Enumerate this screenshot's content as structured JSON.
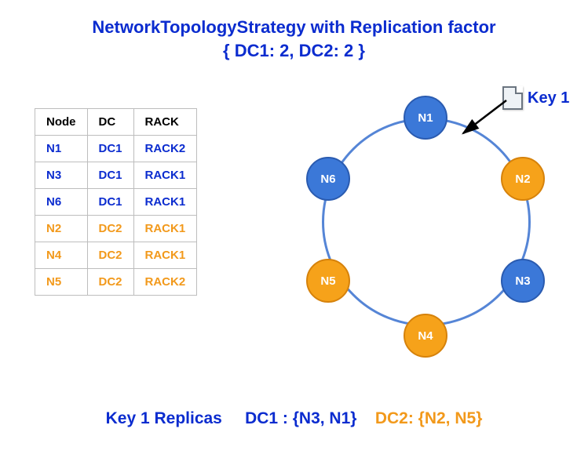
{
  "title_line1": "NetworkTopologyStrategy with Replication factor",
  "title_line2": "{ DC1: 2, DC2: 2 }",
  "table": {
    "headers": {
      "node": "Node",
      "dc": "DC",
      "rack": "RACK"
    },
    "rows": [
      {
        "node": "N1",
        "dc": "DC1",
        "rack": "RACK2",
        "group": "dc1"
      },
      {
        "node": "N3",
        "dc": "DC1",
        "rack": "RACK1",
        "group": "dc1"
      },
      {
        "node": "N6",
        "dc": "DC1",
        "rack": "RACK1",
        "group": "dc1"
      },
      {
        "node": "N2",
        "dc": "DC2",
        "rack": "RACK1",
        "group": "dc2"
      },
      {
        "node": "N4",
        "dc": "DC2",
        "rack": "RACK1",
        "group": "dc2"
      },
      {
        "node": "N5",
        "dc": "DC2",
        "rack": "RACK2",
        "group": "dc2"
      }
    ]
  },
  "ring_nodes": {
    "n1": {
      "label": "N1",
      "color": "blue"
    },
    "n2": {
      "label": "N2",
      "color": "orange"
    },
    "n3": {
      "label": "N3",
      "color": "blue"
    },
    "n4": {
      "label": "N4",
      "color": "orange"
    },
    "n5": {
      "label": "N5",
      "color": "orange"
    },
    "n6": {
      "label": "N6",
      "color": "blue"
    }
  },
  "key": {
    "label": "Key 1"
  },
  "replicas": {
    "prefix": "Key 1 Replicas",
    "dc1": "DC1 : {N3, N1}",
    "dc2": "DC2: {N2, N5}"
  },
  "colors": {
    "blue": "#3b78d8",
    "orange": "#f6a21a",
    "text_blue": "#0b2ccf",
    "text_orange": "#f2991b"
  }
}
